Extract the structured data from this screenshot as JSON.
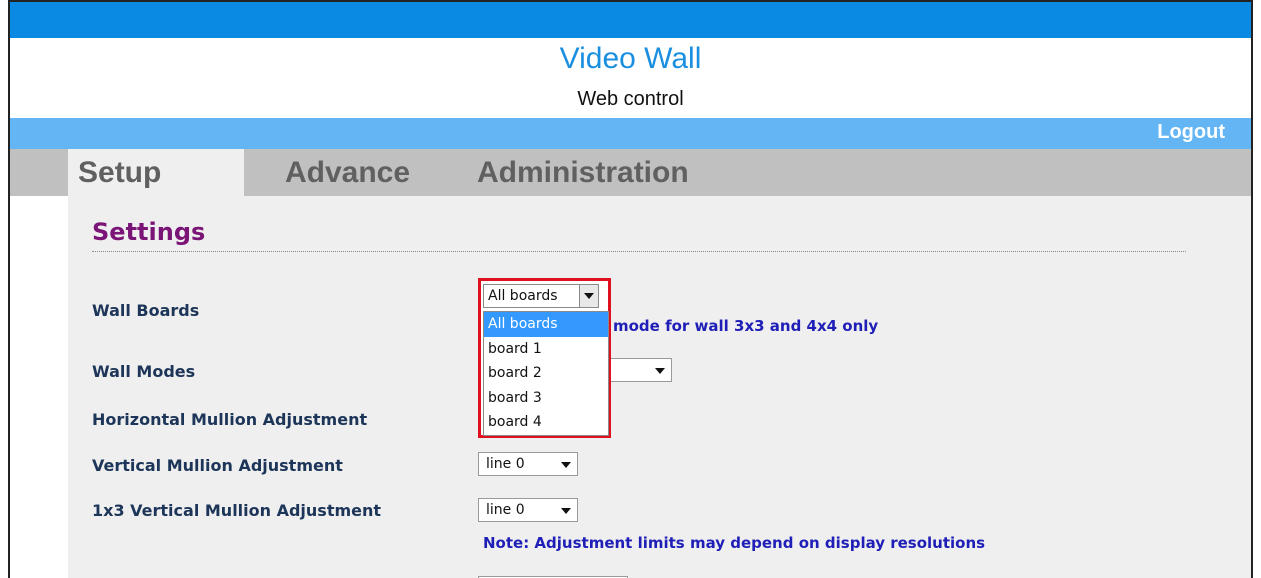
{
  "header": {
    "title": "Video Wall",
    "subtitle": "Web control",
    "logout": "Logout"
  },
  "tabs": [
    {
      "label": "Setup",
      "active": true
    },
    {
      "label": "Advance",
      "active": false
    },
    {
      "label": "Administration",
      "active": false
    }
  ],
  "settings": {
    "title": "Settings",
    "rows": [
      {
        "label": "Wall Boards"
      },
      {
        "label": "Wall Modes"
      },
      {
        "label": "Horizontal Mullion Adjustment"
      },
      {
        "label": "Vertical Mullion Adjustment",
        "value": "line 0"
      },
      {
        "label": "1x3 Vertical Mullion Adjustment",
        "value": "line 0"
      }
    ],
    "wall_boards_note": "mode for wall 3x3 and 4x4 only",
    "adjustment_note": "Note: Adjustment limits may depend on display resolutions"
  },
  "dropdown": {
    "selected": "All boards",
    "options": [
      "All boards",
      "board 1",
      "board 2",
      "board 3",
      "board 4"
    ],
    "highlighted_index": 0
  },
  "colors": {
    "topbar": "#0b8ae3",
    "logoutbar": "#63b6f3",
    "highlight": "#e0101e",
    "accent": "#7a1477"
  }
}
